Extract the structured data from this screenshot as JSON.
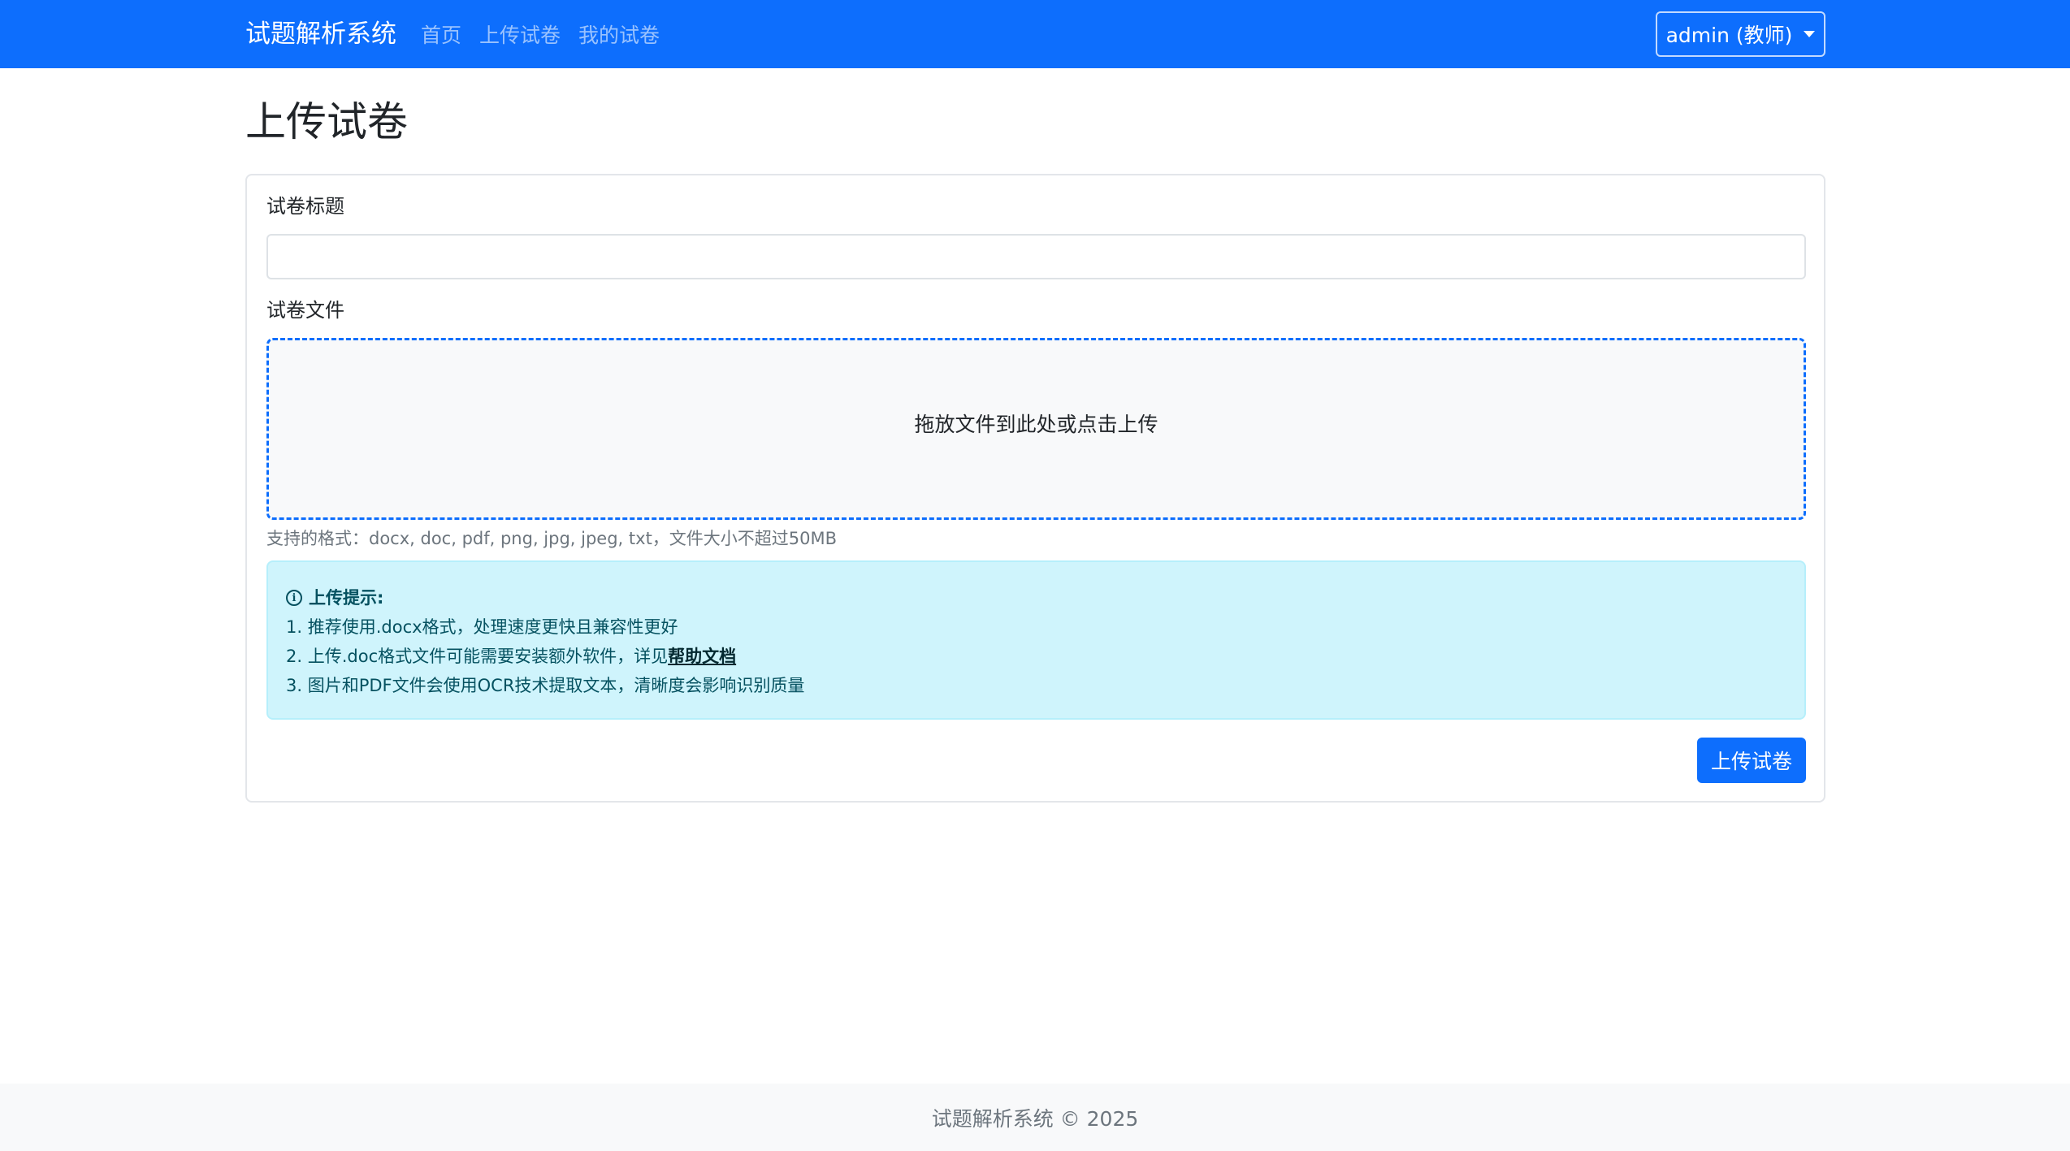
{
  "navbar": {
    "brand": "试题解析系统",
    "links": [
      {
        "label": "首页"
      },
      {
        "label": "上传试卷"
      },
      {
        "label": "我的试卷"
      }
    ],
    "user_label": "admin (教师)"
  },
  "page": {
    "title": "上传试卷"
  },
  "form": {
    "title_label": "试卷标题",
    "title_value": "",
    "file_label": "试卷文件",
    "dropzone_text": "拖放文件到此处或点击上传",
    "help_text": "支持的格式：docx, doc, pdf, png, jpg, jpeg, txt，文件大小不超过50MB",
    "alert": {
      "icon": "info-circle-icon",
      "heading": "上传提示:",
      "line1": "1. 推荐使用.docx格式，处理速度更快且兼容性更好",
      "line2_prefix": "2. 上传.doc格式文件可能需要安装额外软件，详见",
      "line2_link": "帮助文档",
      "line3": "3. 图片和PDF文件会使用OCR技术提取文本，清晰度会影响识别质量"
    },
    "submit_label": "上传试卷"
  },
  "footer": {
    "text": "试题解析系统 © 2025"
  },
  "colors": {
    "primary": "#0d6efd",
    "info_bg": "#cff4fc",
    "info_text": "#055160",
    "footer_bg": "#f8f9fa"
  }
}
